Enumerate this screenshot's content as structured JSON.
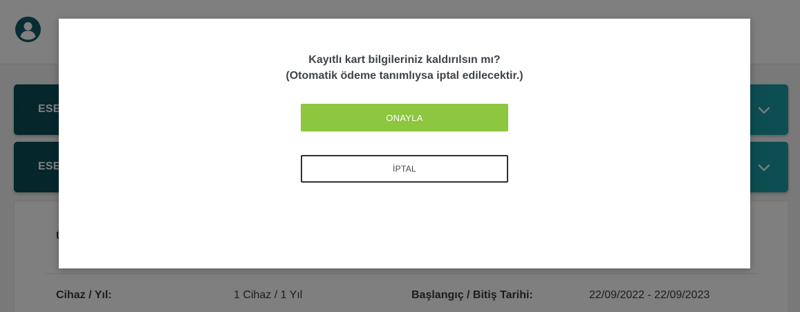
{
  "colors": {
    "accent_green": "#8dc63f",
    "bar_dark": "#0b4b55",
    "bar_light": "#1a9ea6",
    "avatar": "#0f5d66"
  },
  "header": {
    "avatar_icon": "user-circle-icon"
  },
  "accordions": [
    {
      "label": "ESE",
      "chevron_icon": "chevron-down-icon"
    },
    {
      "label": "ESE",
      "chevron_icon": "chevron-down-icon"
    }
  ],
  "card": {
    "heading": "Ü",
    "device_label": "Cihaz / Yıl:",
    "device_value": "1 Cihaz / 1 Yıl",
    "dates_label": "Başlangıç / Bitiş Tarihi:",
    "dates_value": "22/09/2022 - 22/09/2023"
  },
  "modal": {
    "message_line1": "Kayıtlı kart bilgileriniz kaldırılsın mı?",
    "message_line2": "(Otomatik ödeme tanımlıysa iptal edilecektir.)",
    "confirm_label": "ONAYLA",
    "cancel_label": "İPTAL"
  }
}
